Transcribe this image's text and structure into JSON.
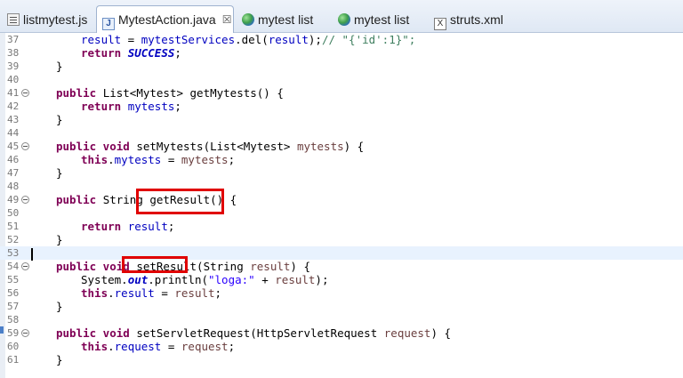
{
  "tabs": [
    {
      "label": "listmytest.js",
      "icon": "js-file-icon"
    },
    {
      "label": "MytestAction.java",
      "icon": "java-file-icon",
      "active": true,
      "close": "☒"
    },
    {
      "label": "mytest list",
      "icon": "globe-icon"
    },
    {
      "label": "mytest list",
      "icon": "globe-icon"
    },
    {
      "label": "struts.xml",
      "icon": "xml-file-icon",
      "icon_text": "X"
    }
  ],
  "java_icon_text": "J",
  "editor": {
    "line_numbers": [
      "37",
      "38",
      "39",
      "40",
      "41",
      "42",
      "43",
      "44",
      "45",
      "46",
      "47",
      "48",
      "49",
      "50",
      "51",
      "52",
      "53",
      "54",
      "55",
      "56",
      "57",
      "58",
      "59",
      "60",
      "61"
    ],
    "code": {
      "l37": {
        "a": "result",
        "b": " = ",
        "c": "mytestServices",
        "d": ".del(",
        "e": "result",
        "f": ");",
        "g": "// \"{'id':1}\";"
      },
      "l38": {
        "a": "return ",
        "b": "SUCCESS",
        "c": ";"
      },
      "l39": "}",
      "l41": {
        "a": "public ",
        "b": "List<Mytest> getMytests() {"
      },
      "l42": {
        "a": "return ",
        "b": "mytests",
        "c": ";"
      },
      "l43": "}",
      "l45": {
        "a": "public void ",
        "b": "setMytests(List<Mytest> ",
        "c": "mytests",
        "d": ") {"
      },
      "l46": {
        "a": "this",
        "b": ".",
        "c": "mytests",
        "d": " = ",
        "e": "mytests",
        "f": ";"
      },
      "l47": "}",
      "l49": {
        "a": "public ",
        "b": "String getResult() {"
      },
      "l51": {
        "a": "return ",
        "b": "result",
        "c": ";"
      },
      "l52": "}",
      "l54": {
        "a": "public void ",
        "b": "setResult(String ",
        "c": "result",
        "d": ") {"
      },
      "l55": {
        "a": "System.",
        "b": "out",
        "c": ".println(",
        "d": "\"loga:\"",
        "e": " + ",
        "f": "result",
        "g": ");"
      },
      "l56": {
        "a": "this",
        "b": ".",
        "c": "result",
        "d": " = ",
        "e": "result",
        "f": ";"
      },
      "l57": "}",
      "l59": {
        "a": "public void ",
        "b": "setServletRequest(HttpServletRequest ",
        "c": "request",
        "d": ") {"
      },
      "l60": {
        "a": "this",
        "b": ".",
        "c": "request",
        "d": " = ",
        "e": "request",
        "f": ";"
      },
      "l61": "}"
    }
  },
  "colors": {
    "keyword": "#7f0055",
    "field": "#0000c0",
    "string": "#2a00ff",
    "comment": "#3f7f5f",
    "param": "#6a3e3e",
    "highlight_box": "#e00000",
    "current_line": "#e8f2fe"
  }
}
